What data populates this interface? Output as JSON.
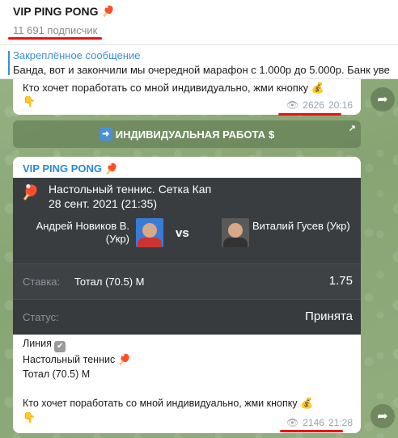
{
  "header": {
    "title": "VIP PING PONG",
    "title_emoji": "🏓",
    "subscribers": "11 691 подписчик"
  },
  "pinned": {
    "title": "Закреплённое сообщение",
    "text": "Банда, вот и закончили мы очередной марафон с 1.000р до 5.000р. Банк уве"
  },
  "message1": {
    "text": "Кто хочет поработать со мной индивидуально, жми кнопку",
    "text_emoji": "💰",
    "second_line_emoji": "👇",
    "views": "2626",
    "time": "20:16"
  },
  "inline_button": {
    "icon": "➡️",
    "label": "ИНДИВИДУАЛЬНАЯ РАБОТА",
    "suffix": "$",
    "corner": "↗"
  },
  "message2": {
    "title": "VIP PING PONG",
    "title_emoji": "🏓",
    "card": {
      "sport": "Настольный теннис. Сетка Кап",
      "date": "28 сент. 2021 (21:35)",
      "player1": "Андрей Новиков В. (Укр)",
      "player2": "Виталий Гусев (Укр)",
      "vs": "vs",
      "bet_label": "Ставка:",
      "bet_value": "Тотал (70.5) М",
      "odds": "1.75",
      "status_label": "Статус:",
      "status_value": "Принята"
    },
    "line1": "Линия",
    "line2": "Настольный теннис",
    "line3": "Тотал (70.5) М",
    "cta": "Кто хочет поработать со мной индивидуально, жми кнопку",
    "cta_emoji": "💰",
    "cta_second_emoji": "👇",
    "views": "2146",
    "time": "21:28"
  },
  "colors": {
    "accent": "#2b88d8",
    "pinned_accent": "#3a8fd6",
    "underline": "#e11111",
    "card_bg": "#3a3d40"
  }
}
